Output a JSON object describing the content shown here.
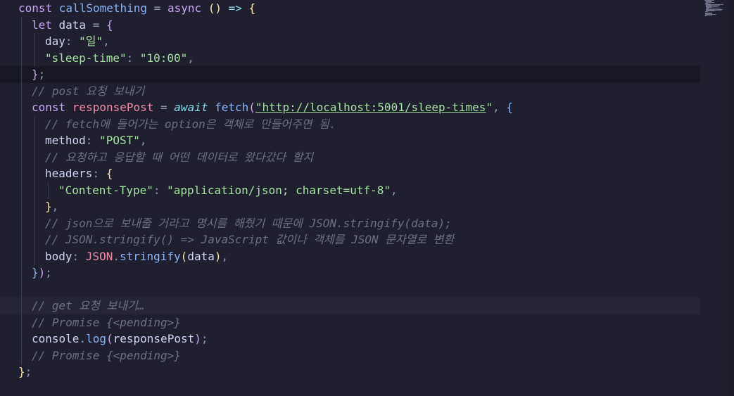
{
  "editor": {
    "lines": [
      [
        [
          "kw",
          "const "
        ],
        [
          "fn",
          "callSomething"
        ],
        [
          "p",
          " = "
        ],
        [
          "kw",
          "async "
        ],
        [
          "brace1",
          "() "
        ],
        [
          "op",
          "=> "
        ],
        [
          "brace1",
          "{"
        ]
      ],
      [
        [
          "kw",
          "let "
        ],
        [
          "prop",
          "data "
        ],
        [
          "p",
          "= "
        ],
        [
          "brace2",
          "{"
        ]
      ],
      [
        [
          "prop",
          "day"
        ],
        [
          "p",
          ": "
        ],
        [
          "str",
          "\"일\""
        ],
        [
          "p",
          ","
        ]
      ],
      [
        [
          "str",
          "\"sleep-time\""
        ],
        [
          "p",
          ": "
        ],
        [
          "str",
          "\"10:00\""
        ],
        [
          "p",
          ","
        ]
      ],
      [
        [
          "brace2",
          "}"
        ],
        [
          "p",
          ";"
        ]
      ],
      [
        [
          "cm",
          "// post 요청 보내기"
        ]
      ],
      [
        [
          "kw",
          "const "
        ],
        [
          "var",
          "responsePost "
        ],
        [
          "p",
          "= "
        ],
        [
          "await",
          "await "
        ],
        [
          "fn",
          "fetch"
        ],
        [
          "brace2",
          "("
        ],
        [
          "url",
          "\"http://localhost:5001/sleep-times"
        ],
        [
          "str",
          "\""
        ],
        [
          "p",
          ", "
        ],
        [
          "brace3",
          "{"
        ]
      ],
      [
        [
          "cm",
          "// fetch에 들어가는 option은 객체로 만들어주면 됨."
        ]
      ],
      [
        [
          "prop",
          "method"
        ],
        [
          "p",
          ": "
        ],
        [
          "str",
          "\"POST\""
        ],
        [
          "p",
          ","
        ]
      ],
      [
        [
          "cm",
          "// 요청하고 응답할 때 어떤 데이터로 왔다갔다 할지"
        ]
      ],
      [
        [
          "prop",
          "headers"
        ],
        [
          "p",
          ": "
        ],
        [
          "brace1",
          "{"
        ]
      ],
      [
        [
          "str",
          "\"Content-Type\""
        ],
        [
          "p",
          ": "
        ],
        [
          "str",
          "\"application/json; charset=utf-8\""
        ],
        [
          "p",
          ","
        ]
      ],
      [
        [
          "brace1",
          "}"
        ],
        [
          "p",
          ","
        ]
      ],
      [
        [
          "cm",
          "// json으로 보내줄 거라고 명시를 해줬기 때문에 JSON.stringify(data);"
        ]
      ],
      [
        [
          "cm",
          "// JSON.stringify() => JavaScript 값이나 객체를 JSON 문자열로 변환"
        ]
      ],
      [
        [
          "prop",
          "body"
        ],
        [
          "p",
          ": "
        ],
        [
          "var",
          "JSON"
        ],
        [
          "p",
          "."
        ],
        [
          "fn",
          "stringify"
        ],
        [
          "brace1",
          "("
        ],
        [
          "prop",
          "data"
        ],
        [
          "brace1",
          ")"
        ],
        [
          "p",
          ","
        ]
      ],
      [
        [
          "brace3",
          "}"
        ],
        [
          "brace2",
          ")"
        ],
        [
          "p",
          ";"
        ]
      ],
      [],
      [
        [
          "cm",
          "// get 요청 보내기…"
        ]
      ],
      [
        [
          "cm",
          "// Promise {<pending>}"
        ]
      ],
      [
        [
          "prop",
          "console"
        ],
        [
          "p",
          "."
        ],
        [
          "fn",
          "log"
        ],
        [
          "brace2",
          "("
        ],
        [
          "prop",
          "responsePost"
        ],
        [
          "brace2",
          ")"
        ],
        [
          "p",
          ";"
        ]
      ],
      [
        [
          "cm",
          "// Promise {<pending>}"
        ]
      ],
      [
        [
          "brace1",
          "}"
        ],
        [
          "p",
          ";"
        ]
      ]
    ],
    "indents": [
      0,
      1,
      2,
      2,
      1,
      1,
      1,
      2,
      2,
      2,
      2,
      3,
      2,
      2,
      2,
      2,
      1,
      1,
      1,
      1,
      1,
      1,
      0
    ],
    "current_line": 4,
    "hover_line": 18,
    "colors": {
      "background": "#1f1f2f",
      "keyword": "#cba6f7",
      "function": "#89b4fa",
      "string": "#a6e3a1",
      "comment": "#6c7086",
      "variable": "#f38ba8"
    }
  }
}
